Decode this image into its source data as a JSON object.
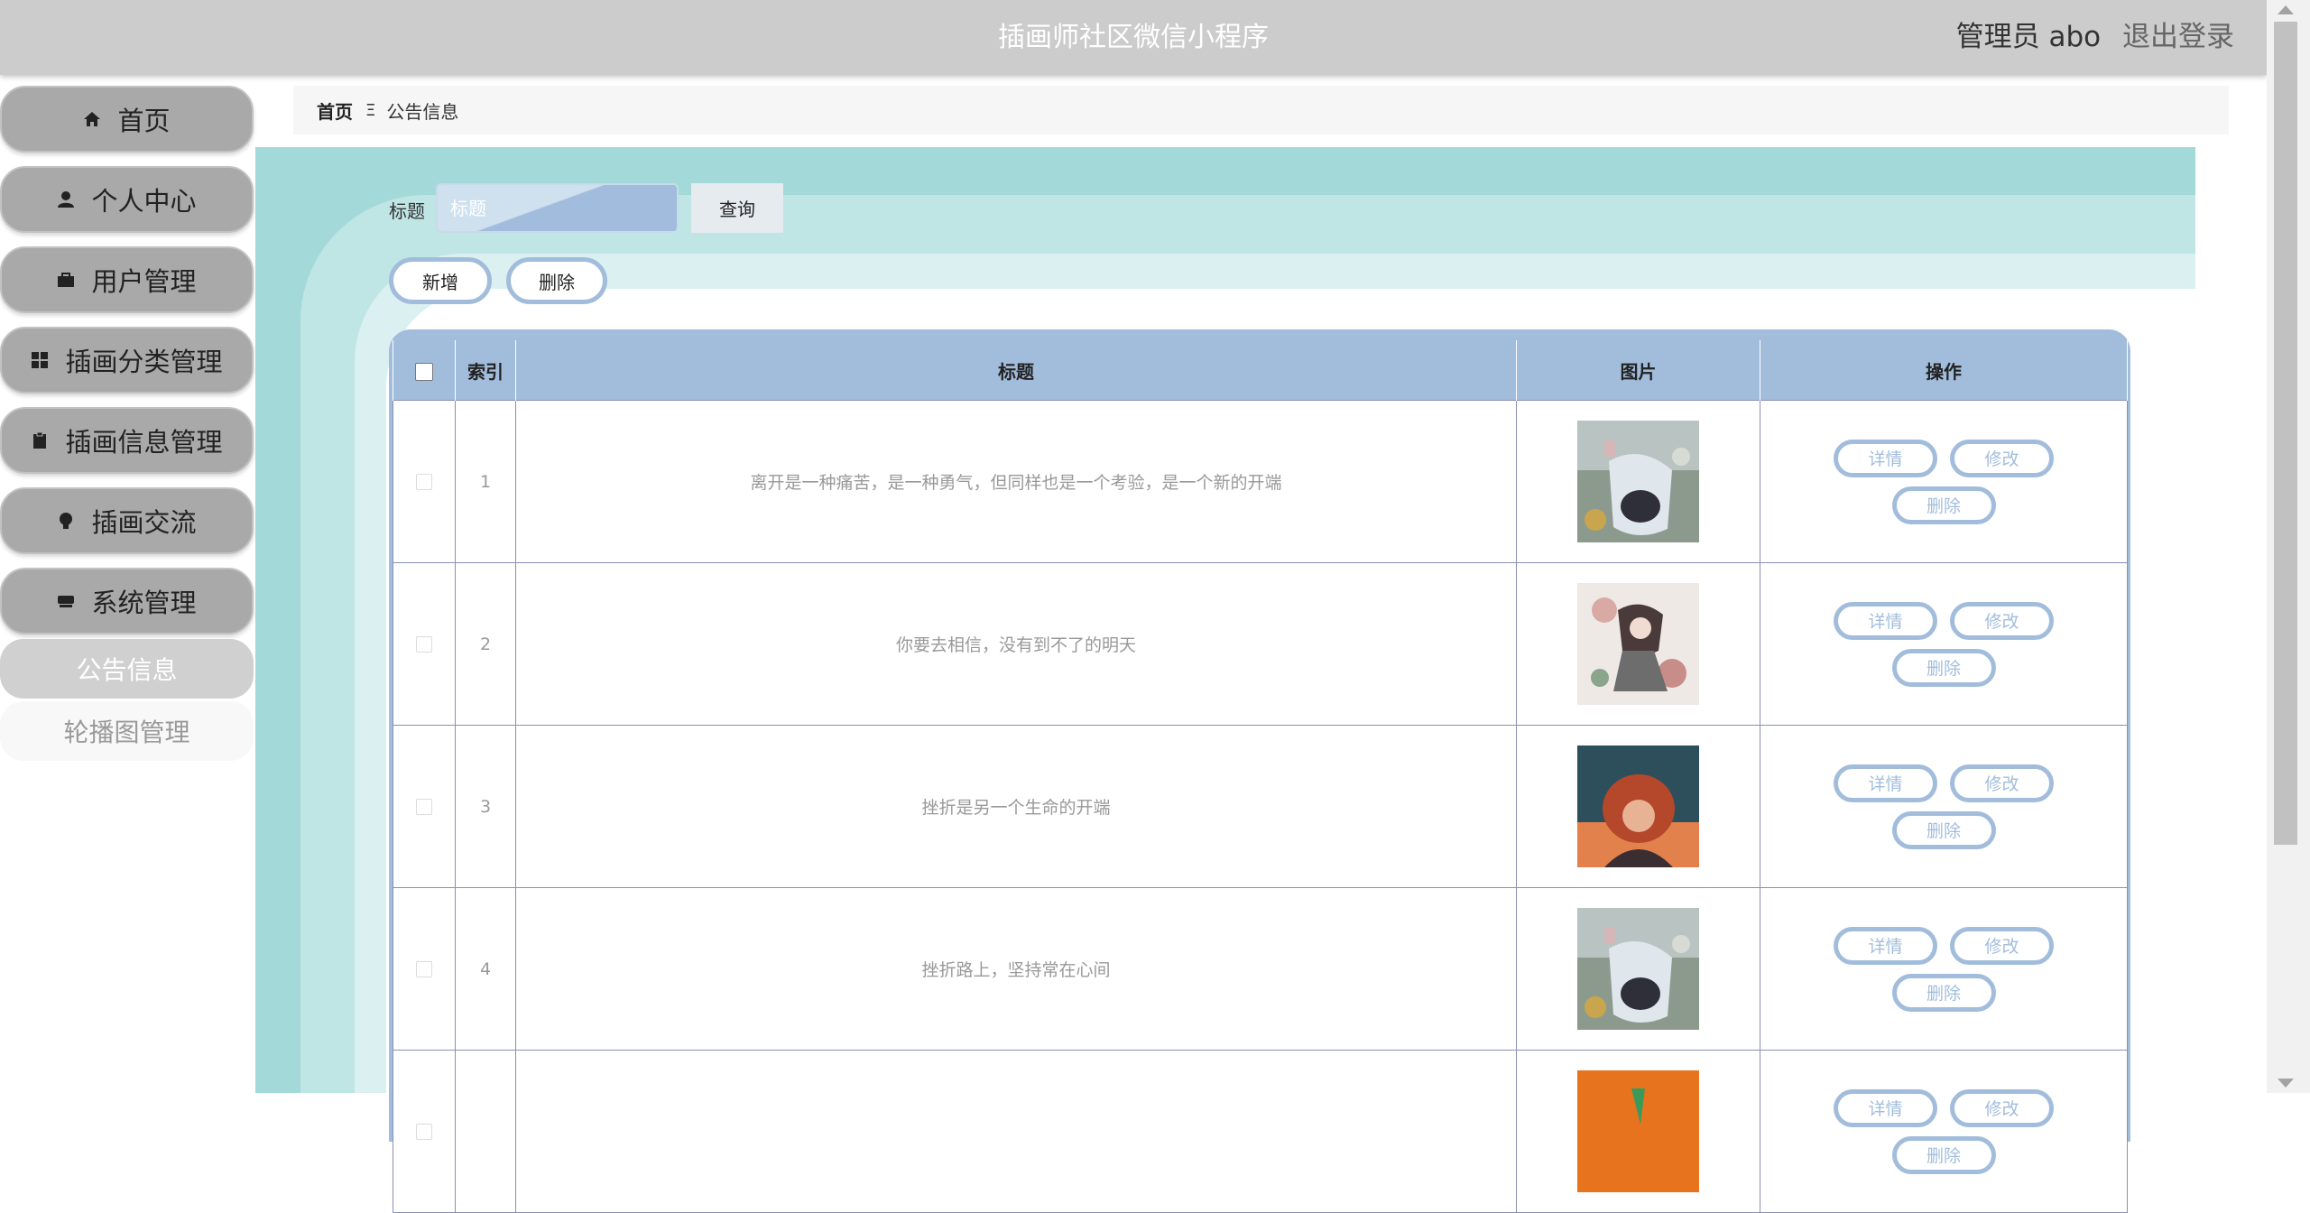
{
  "header": {
    "title": "插画师社区微信小程序",
    "user": "管理员 abo",
    "logout": "退出登录"
  },
  "sidebar": {
    "items": [
      {
        "label": "首页",
        "icon": "home-icon"
      },
      {
        "label": "个人中心",
        "icon": "user-icon"
      },
      {
        "label": "用户管理",
        "icon": "briefcase-icon"
      },
      {
        "label": "插画分类管理",
        "icon": "grid-icon"
      },
      {
        "label": "插画信息管理",
        "icon": "clipboard-icon"
      },
      {
        "label": "插画交流",
        "icon": "bulb-icon"
      },
      {
        "label": "系统管理",
        "icon": "drive-icon"
      }
    ],
    "sub_items": [
      {
        "label": "公告信息",
        "active": true
      },
      {
        "label": "轮播图管理",
        "active": false
      }
    ]
  },
  "breadcrumb": {
    "home": "首页",
    "separator": "Ξ",
    "current": "公告信息"
  },
  "search": {
    "label": "标题",
    "placeholder": "标题",
    "value": "",
    "query_button": "查询"
  },
  "actions": {
    "add": "新增",
    "delete": "删除"
  },
  "table": {
    "columns": [
      "",
      "索引",
      "标题",
      "图片",
      "操作"
    ],
    "rows": [
      {
        "index": "1",
        "title": "离开是一种痛苦，是一种勇气，但同样也是一个考验，是一个新的开端",
        "image": "illustration-girl-sitting"
      },
      {
        "index": "2",
        "title": "你要去相信，没有到不了的明天",
        "image": "illustration-girl-floral"
      },
      {
        "index": "3",
        "title": "挫折是另一个生命的开端",
        "image": "illustration-girl-sunset"
      },
      {
        "index": "4",
        "title": "挫折路上，坚持常在心间",
        "image": "illustration-girl-sitting"
      },
      {
        "index": "",
        "title": "",
        "image": "illustration-orange"
      }
    ],
    "row_actions": {
      "detail": "详情",
      "edit": "修改",
      "delete": "删除"
    }
  },
  "colors": {
    "header_bg": "#cccccc",
    "nav_bg": "#a9a9a9",
    "accent": "#a2bddc",
    "teal_bg": "#a3dad9"
  }
}
